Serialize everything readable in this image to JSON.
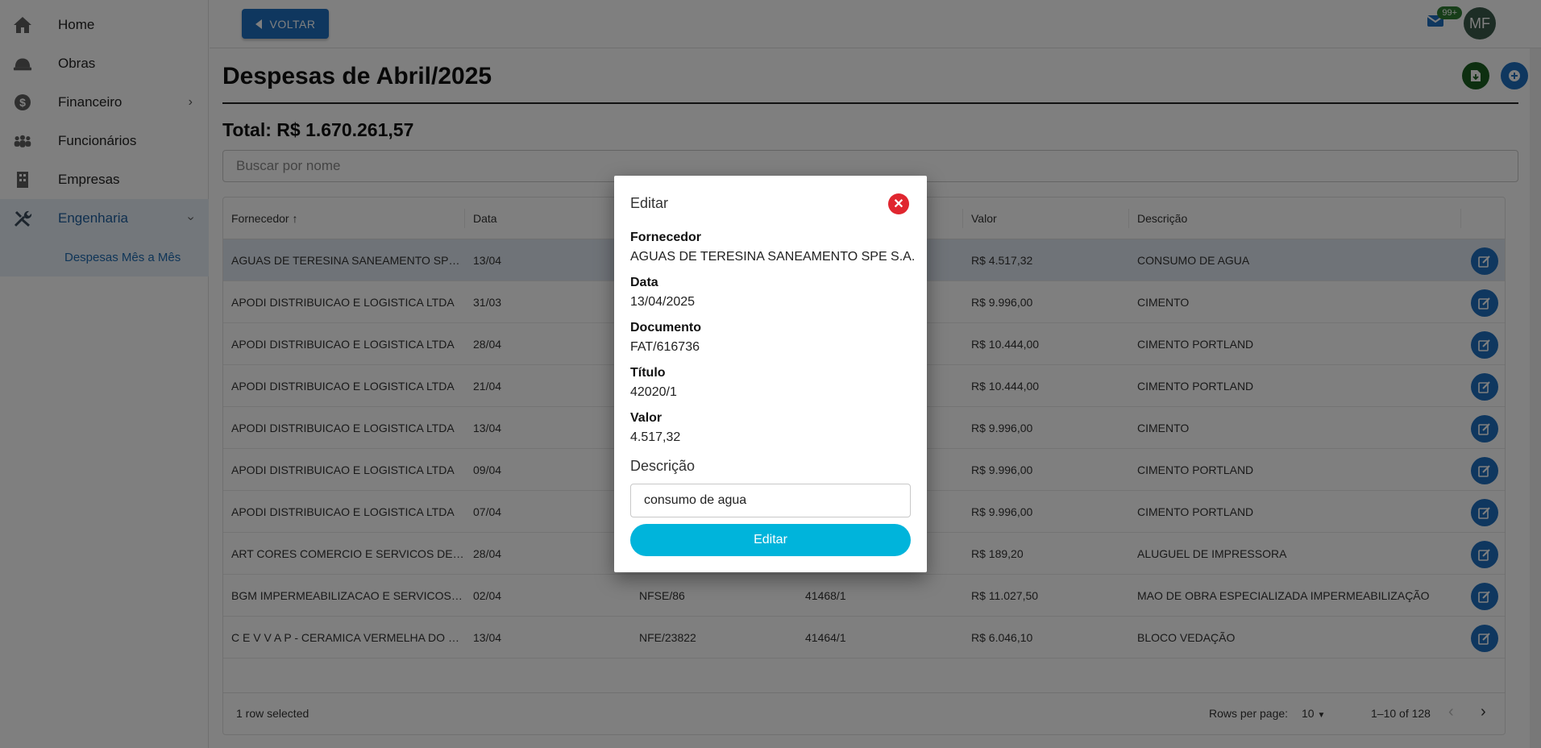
{
  "sidebar": {
    "items": [
      {
        "label": "Home",
        "icon": "home-icon"
      },
      {
        "label": "Obras",
        "icon": "hard-hat-icon"
      },
      {
        "label": "Financeiro",
        "icon": "dollar-icon"
      },
      {
        "label": "Funcionários",
        "icon": "people-icon"
      },
      {
        "label": "Empresas",
        "icon": "building-icon"
      },
      {
        "label": "Engenharia",
        "icon": "tools-icon"
      }
    ],
    "subitem": "Despesas Mês a Mês"
  },
  "header": {
    "back_label": "VOLTAR",
    "badge": "99+",
    "avatar": "MF"
  },
  "page": {
    "title": "Despesas de Abril/2025",
    "total": "Total: R$ 1.670.261,57",
    "search_placeholder": "Buscar por nome"
  },
  "table": {
    "columns": [
      "Fornecedor",
      "Data",
      "",
      "",
      "Valor",
      "Descrição"
    ],
    "rows": [
      [
        "AGUAS DE TERESINA SANEAMENTO SPE S...",
        "13/04",
        "",
        "",
        "R$ 4.517,32",
        "CONSUMO DE AGUA"
      ],
      [
        "APODI DISTRIBUICAO E LOGISTICA LTDA",
        "31/03",
        "",
        "",
        "R$ 9.996,00",
        "CIMENTO"
      ],
      [
        "APODI DISTRIBUICAO E LOGISTICA LTDA",
        "28/04",
        "",
        "",
        "R$ 10.444,00",
        "CIMENTO PORTLAND"
      ],
      [
        "APODI DISTRIBUICAO E LOGISTICA LTDA",
        "21/04",
        "",
        "",
        "R$ 10.444,00",
        "CIMENTO PORTLAND"
      ],
      [
        "APODI DISTRIBUICAO E LOGISTICA LTDA",
        "13/04",
        "",
        "",
        "R$ 9.996,00",
        "CIMENTO"
      ],
      [
        "APODI DISTRIBUICAO E LOGISTICA LTDA",
        "09/04",
        "",
        "",
        "R$ 9.996,00",
        "CIMENTO PORTLAND"
      ],
      [
        "APODI DISTRIBUICAO E LOGISTICA LTDA",
        "07/04",
        "",
        "",
        "R$ 9.996,00",
        "CIMENTO PORTLAND"
      ],
      [
        "ART CORES COMERCIO E SERVICOS DE IN...",
        "28/04",
        "",
        "",
        "R$ 189,20",
        "ALUGUEL DE IMPRESSORA"
      ],
      [
        "BGM IMPERMEABILIZACAO E SERVICOS L...",
        "02/04",
        "NFSE/86",
        "41468/1",
        "R$ 11.027,50",
        "MAO DE OBRA ESPECIALIZADA IMPERMEABILIZAÇÃO"
      ],
      [
        "C E V V A P - CERAMICA VERMELHA DO VA...",
        "13/04",
        "NFE/23822",
        "41464/1",
        "R$ 6.046,10",
        "BLOCO VEDAÇÃO"
      ]
    ],
    "footer": {
      "selected": "1 row selected",
      "rows_per_page_label": "Rows per page:",
      "rows_per_page": "10",
      "range": "1–10 of 128"
    }
  },
  "modal": {
    "title": "Editar",
    "fields": [
      {
        "label": "Fornecedor",
        "value": "AGUAS DE TERESINA SANEAMENTO SPE S.A."
      },
      {
        "label": "Data",
        "value": "13/04/2025"
      },
      {
        "label": "Documento",
        "value": "FAT/616736"
      },
      {
        "label": "Título",
        "value": "42020/1"
      },
      {
        "label": "Valor",
        "value": "4.517,32"
      }
    ],
    "desc_label": "Descrição",
    "desc_value": "consumo de agua",
    "submit_label": "Editar"
  },
  "colors": {
    "primary": "#1f6fbf",
    "accent": "#00b4db",
    "danger": "#e0262f",
    "success": "#1b5e20"
  }
}
